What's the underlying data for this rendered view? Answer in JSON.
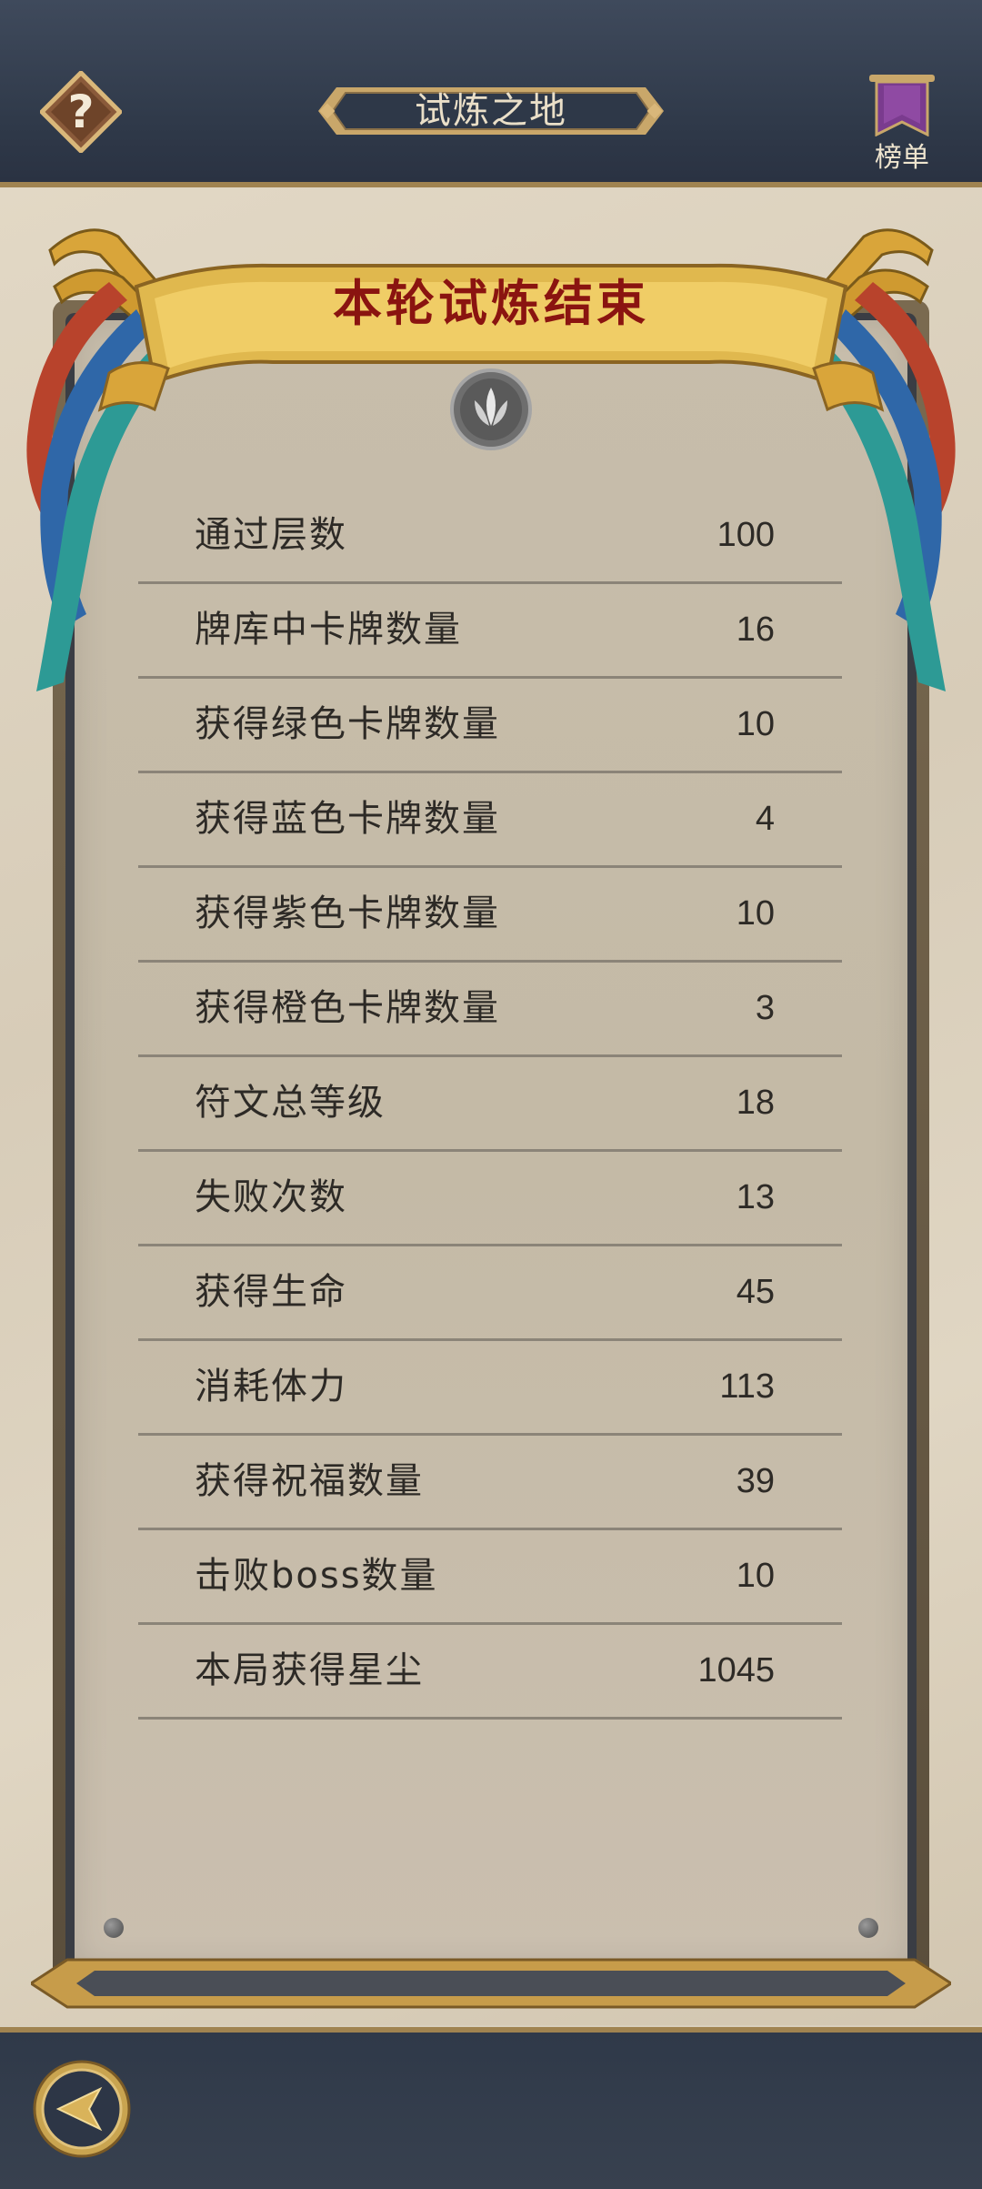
{
  "header": {
    "title": "试炼之地",
    "rank_label": "榜单",
    "help_icon": "question-mark-icon",
    "rank_icon": "purple-banner-icon"
  },
  "panel": {
    "banner_title": "本轮试炼结束",
    "emblem_icon": "leaf-crest-icon",
    "stats": [
      {
        "label": "通过层数",
        "value": "100"
      },
      {
        "label": "牌库中卡牌数量",
        "value": "16"
      },
      {
        "label": "获得绿色卡牌数量",
        "value": "10"
      },
      {
        "label": "获得蓝色卡牌数量",
        "value": "4"
      },
      {
        "label": "获得紫色卡牌数量",
        "value": "10"
      },
      {
        "label": "获得橙色卡牌数量",
        "value": "3"
      },
      {
        "label": "符文总等级",
        "value": "18"
      },
      {
        "label": "失败次数",
        "value": "13"
      },
      {
        "label": "获得生命",
        "value": "45"
      },
      {
        "label": "消耗体力",
        "value": "113"
      },
      {
        "label": "获得祝福数量",
        "value": "39"
      },
      {
        "label": "击败boss数量",
        "value": "10"
      },
      {
        "label": "本局获得星尘",
        "value": "1045"
      }
    ]
  },
  "footer": {
    "back_icon": "back-arrow-icon"
  },
  "colors": {
    "header_bg": "#2f3949",
    "gold_trim": "#a08350",
    "banner_text": "#8a1410",
    "paper": "#c7bdab"
  }
}
